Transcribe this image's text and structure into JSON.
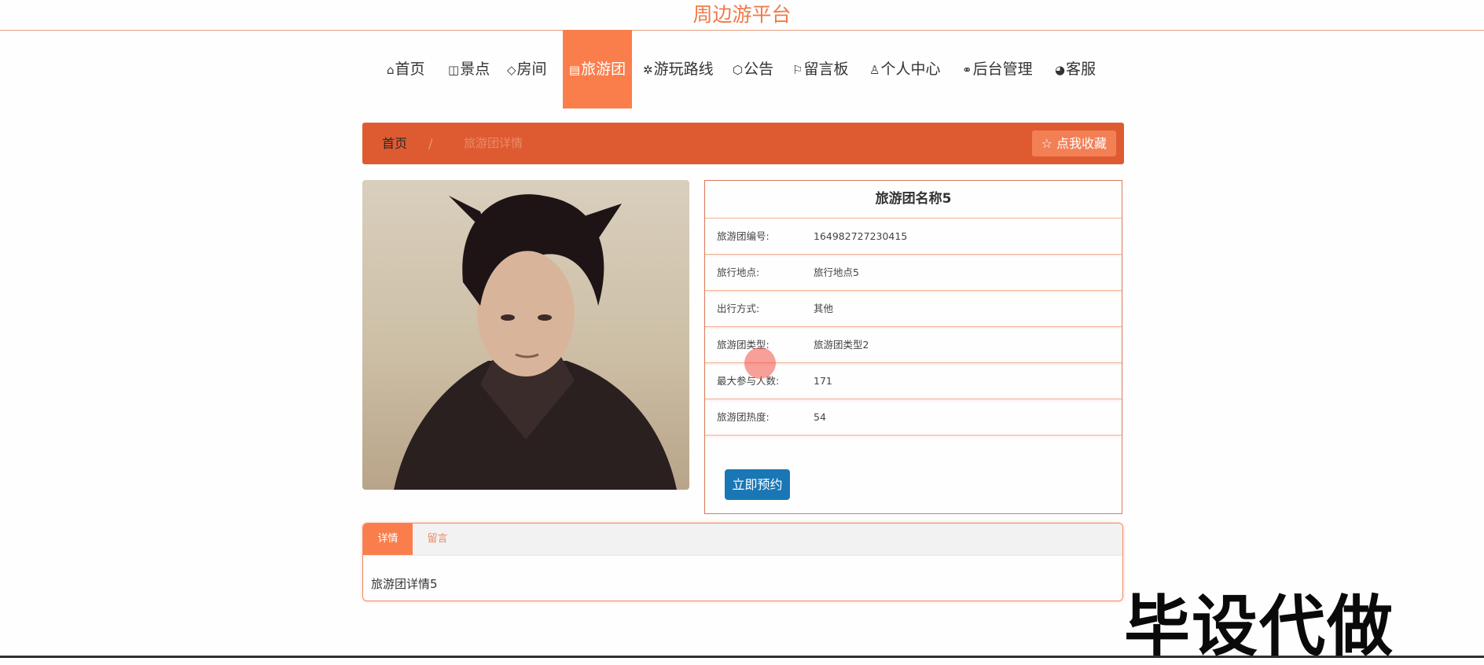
{
  "site": {
    "title": "周边游平台"
  },
  "nav": {
    "items": [
      {
        "icon": "home-icon",
        "glyph": "⌂",
        "label": "首页"
      },
      {
        "icon": "scenic-icon",
        "glyph": "◫",
        "label": "景点"
      },
      {
        "icon": "tag-icon",
        "glyph": "◇",
        "label": "房间"
      },
      {
        "icon": "tour-group-icon",
        "glyph": "▤",
        "label": "旅游团"
      },
      {
        "icon": "route-icon",
        "glyph": "✲",
        "label": "游玩路线"
      },
      {
        "icon": "cube-icon",
        "glyph": "⬡",
        "label": "公告"
      },
      {
        "icon": "flag-icon",
        "glyph": "⚐",
        "label": "留言板"
      },
      {
        "icon": "user-icon",
        "glyph": "♙",
        "label": "个人中心"
      },
      {
        "icon": "link-icon",
        "glyph": "⚭",
        "label": "后台管理"
      },
      {
        "icon": "service-icon",
        "glyph": "◕",
        "label": "客服"
      }
    ],
    "active": "旅游团"
  },
  "breadcrumb": {
    "home": "首页",
    "separator": "/",
    "current": "旅游团详情",
    "favorite_label": "☆ 点我收藏"
  },
  "detail": {
    "title": "旅游团名称5",
    "rows": [
      {
        "label": "旅游团编号:",
        "value": "164982727230415"
      },
      {
        "label": "旅行地点:",
        "value": "旅行地点5"
      },
      {
        "label": "出行方式:",
        "value": "其他"
      },
      {
        "label": "旅游团类型:",
        "value": "旅游团类型2"
      },
      {
        "label": "最大参与人数:",
        "value": "171"
      },
      {
        "label": "旅游团热度:",
        "value": "54"
      }
    ],
    "book_label": "立即预约"
  },
  "tabs": {
    "items": [
      "详情",
      "留言"
    ],
    "content": "旅游团详情5"
  },
  "watermark": "毕设代做",
  "colors": {
    "accent": "#fa7e4c",
    "breadcrumb_bg": "#de5b32",
    "title": "#f07a4a",
    "primary_button": "#1a77b5"
  }
}
